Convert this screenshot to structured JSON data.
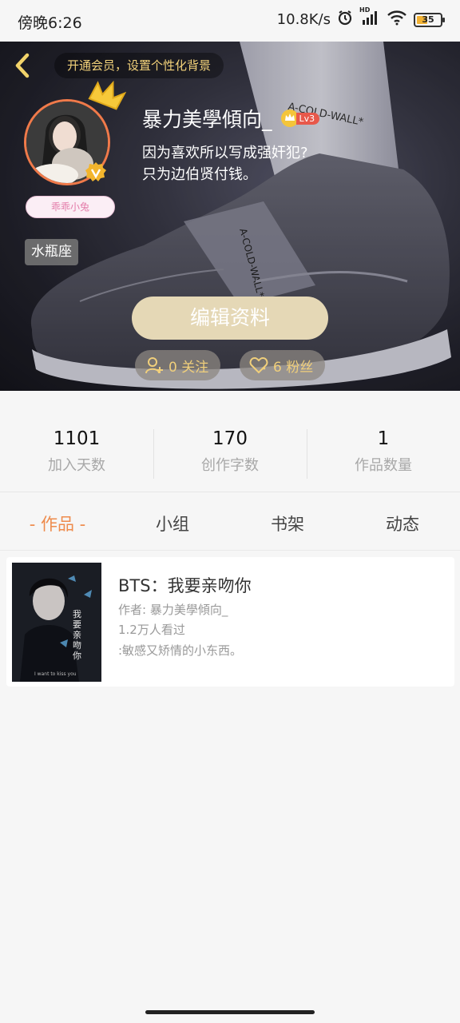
{
  "status_bar": {
    "time": "傍晚6:26",
    "speed": "10.8K/s",
    "hd": "HD",
    "battery": "35"
  },
  "header": {
    "vip_banner": "开通会员，设置个性化背景",
    "username": "暴力美學傾向_",
    "level": "Lv3",
    "bio_line1": "因为喜欢所以写成强奸犯?",
    "bio_line2": "只为边伯贤付钱。",
    "pet_tag": "乖乖小兔",
    "zodiac": "水瓶座",
    "edit_button": "编辑资料",
    "follow_label": "0 关注",
    "fans_label": "6 粉丝",
    "accent_color": "#f0cf7b"
  },
  "stats": [
    {
      "value": "1101",
      "label": "加入天数"
    },
    {
      "value": "170",
      "label": "创作字数"
    },
    {
      "value": "1",
      "label": "作品数量"
    }
  ],
  "tabs": [
    {
      "label": "- 作品 -",
      "active": true
    },
    {
      "label": "小组",
      "active": false
    },
    {
      "label": "书架",
      "active": false
    },
    {
      "label": "动态",
      "active": false
    }
  ],
  "works": [
    {
      "title": "BTS：我要亲吻你",
      "author": "作者: 暴力美學傾向_",
      "views": "1.2万人看过",
      "description": ":敏感又矫情的小东西。",
      "cover_title": "我要亲吻你",
      "cover_sub": "I want to kiss you"
    }
  ]
}
